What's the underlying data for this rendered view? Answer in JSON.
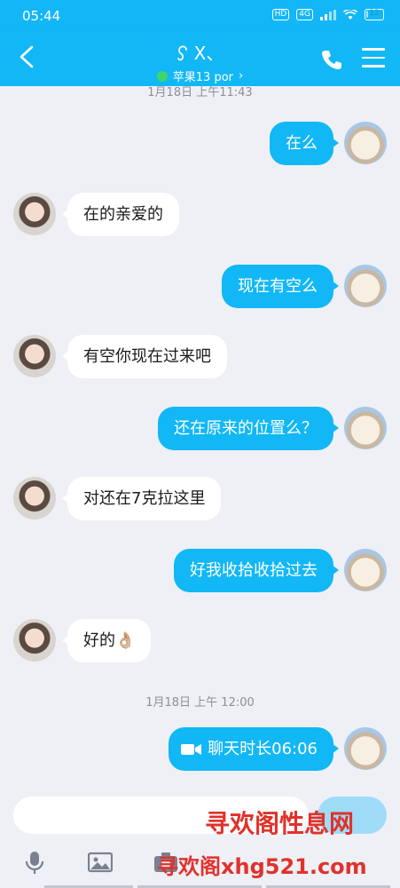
{
  "status_bar": {
    "time": "05:44",
    "hd_label": "HD",
    "net_label": "4G",
    "battery": "12",
    "battery_level": 0.12
  },
  "header": {
    "contact_name": "X、",
    "device_status": "苹果13 por",
    "subtitle_chevron": "›"
  },
  "chat": {
    "timestamps": [
      "1月18日 上午11:43",
      "1月18日 上午 12:00"
    ],
    "messages": [
      {
        "dir": "out",
        "text": "在么"
      },
      {
        "dir": "in",
        "text": "在的亲爱的"
      },
      {
        "dir": "out",
        "text": "现在有空么"
      },
      {
        "dir": "in",
        "text": "有空你现在过来吧"
      },
      {
        "dir": "out",
        "text": "还在原来的位置么？"
      },
      {
        "dir": "in",
        "text": "对还在7克拉这里"
      },
      {
        "dir": "out",
        "text": "好我收拾收拾过去"
      },
      {
        "dir": "in",
        "text": "好的👌🏼"
      },
      {
        "dir": "out",
        "text": "聊天时长06:06",
        "icon": "video-icon"
      }
    ]
  },
  "composer": {
    "input_value": "",
    "send_label": ""
  },
  "watermark": {
    "line1": "寻欢阁性息网",
    "line2": "寻欢阁xhg521.com"
  },
  "colors": {
    "accent": "#12b7f5",
    "chat_bg": "#eef0f6",
    "online": "#3ed56b"
  }
}
